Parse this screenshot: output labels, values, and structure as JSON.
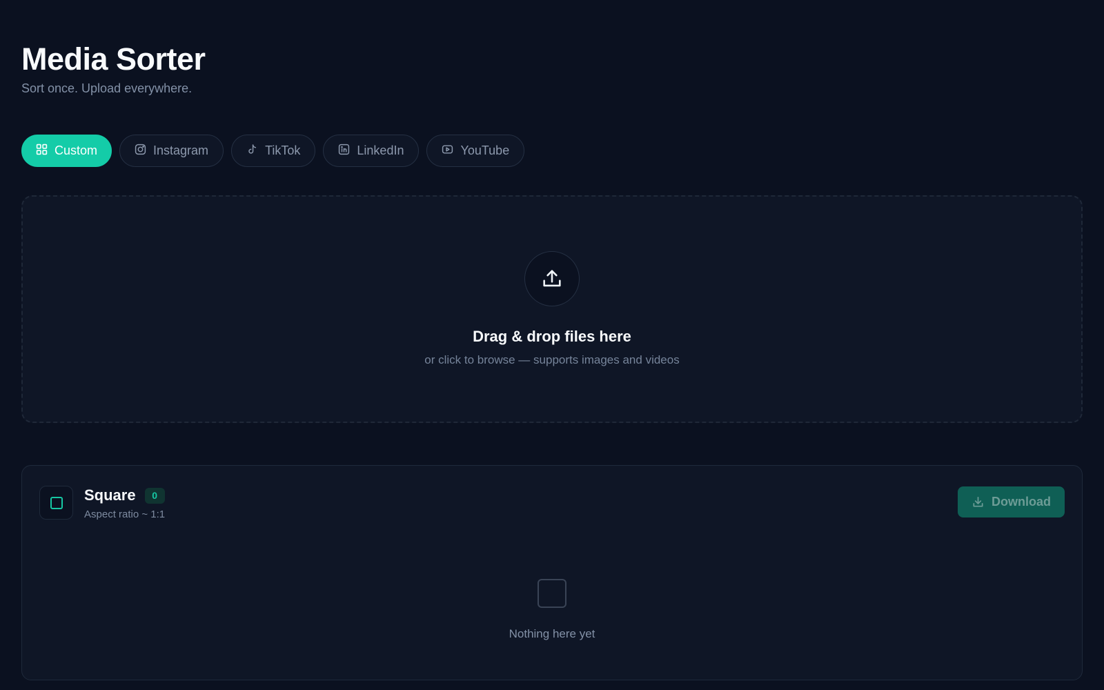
{
  "app": {
    "title": "Media Sorter",
    "subtitle": "Sort once. Upload everywhere."
  },
  "colors": {
    "background": "#0b1120",
    "surface": "#0f1626",
    "accent": "#14cca8",
    "download_disabled": "#0f5f55"
  },
  "tabs": [
    {
      "label": "Custom",
      "icon": "grid-icon",
      "active": true
    },
    {
      "label": "Instagram",
      "icon": "instagram-icon",
      "active": false
    },
    {
      "label": "TikTok",
      "icon": "tiktok-icon",
      "active": false
    },
    {
      "label": "LinkedIn",
      "icon": "linkedin-icon",
      "active": false
    },
    {
      "label": "YouTube",
      "icon": "youtube-icon",
      "active": false
    }
  ],
  "dropzone": {
    "icon": "upload-icon",
    "title": "Drag & drop files here",
    "subtitle": "or click to browse — supports images and videos"
  },
  "buckets": [
    {
      "name": "Square",
      "count": "0",
      "ratio": "Aspect ratio ~ 1:1",
      "icon": "square-icon",
      "download_label": "Download",
      "download_icon": "download-icon",
      "empty_icon": "empty-square-icon",
      "empty_text": "Nothing here yet"
    }
  ]
}
